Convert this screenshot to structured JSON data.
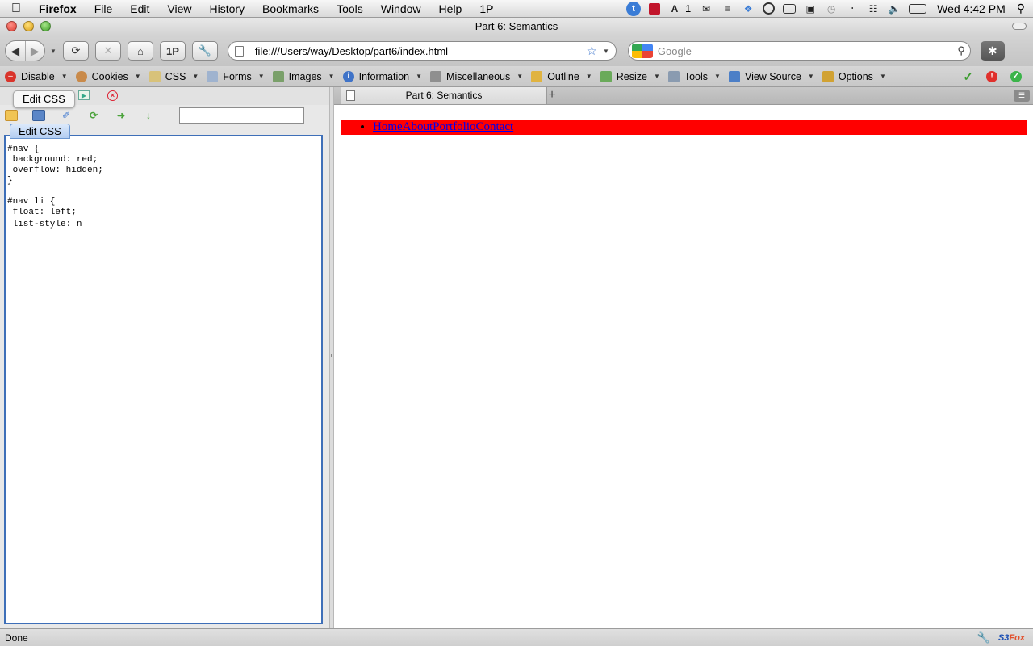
{
  "menubar": {
    "app": "Firefox",
    "items": [
      "File",
      "Edit",
      "View",
      "History",
      "Bookmarks",
      "Tools",
      "Window",
      "Help",
      "1P"
    ],
    "status_badge": "1",
    "clock": "Wed 4:42 PM"
  },
  "window": {
    "title": "Part 6: Semantics"
  },
  "navbar": {
    "onepassword_label": "1P",
    "url": "file:///Users/way/Desktop/part6/index.html",
    "search_placeholder": "Google"
  },
  "devbar": {
    "items": [
      "Disable",
      "Cookies",
      "CSS",
      "Forms",
      "Images",
      "Information",
      "Miscellaneous",
      "Outline",
      "Resize",
      "Tools",
      "View Source",
      "Options"
    ]
  },
  "sidebar": {
    "tooltip": "Edit CSS",
    "tab_label": "Edit CSS",
    "css_text": "#nav {\n background: red;\n overflow: hidden;\n}\n\n#nav li {\n float: left;\n list-style: n"
  },
  "browser": {
    "tab_title": "Part 6: Semantics",
    "new_tab": "+",
    "nav_links": [
      "Home",
      "About",
      "Portfolio",
      "Contact"
    ]
  },
  "status": {
    "text": "Done",
    "addon_label": "S3Fox"
  },
  "colors": {
    "nav_background": "#ff0000",
    "link": "#0000ee",
    "editor_border": "#3e6fb8"
  }
}
